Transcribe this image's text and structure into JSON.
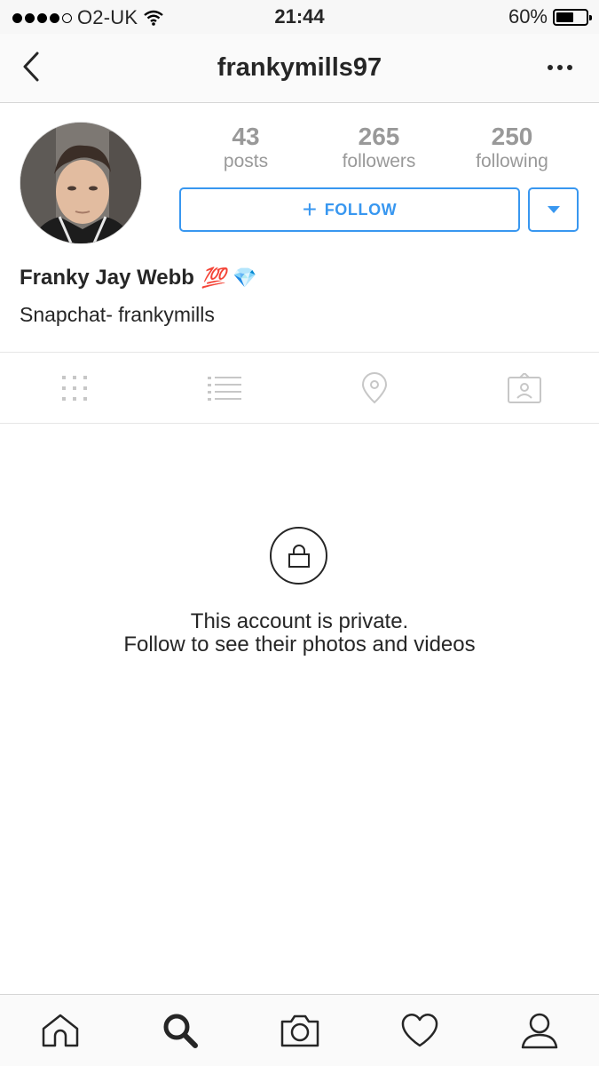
{
  "status_bar": {
    "carrier": "O2-UK",
    "time": "21:44",
    "battery": "60%",
    "battery_level": 0.6
  },
  "nav": {
    "title": "frankymills97",
    "back_icon": "chevron-left-icon",
    "more_icon": "more-horizontal-icon"
  },
  "profile": {
    "stats": [
      {
        "value": "43",
        "label": "posts"
      },
      {
        "value": "265",
        "label": "followers"
      },
      {
        "value": "250",
        "label": "following"
      }
    ],
    "follow_plus": "+",
    "follow_label": "FOLLOW",
    "name": "Franky Jay Webb",
    "name_emoji_1": "💯",
    "name_emoji_2": "💎",
    "bio": "Snapchat- frankymills"
  },
  "tabs": [
    {
      "icon": "grid-icon"
    },
    {
      "icon": "list-icon"
    },
    {
      "icon": "location-pin-icon"
    },
    {
      "icon": "tagged-photos-icon"
    }
  ],
  "private": {
    "title": "This account is private.",
    "subtitle": "Follow to see their photos and videos"
  },
  "bottom_nav": [
    {
      "icon": "home-icon"
    },
    {
      "icon": "search-icon"
    },
    {
      "icon": "camera-icon"
    },
    {
      "icon": "heart-icon"
    },
    {
      "icon": "profile-icon"
    }
  ],
  "colors": {
    "accent": "#3897f0",
    "muted_text": "#999999",
    "text": "#262626"
  }
}
